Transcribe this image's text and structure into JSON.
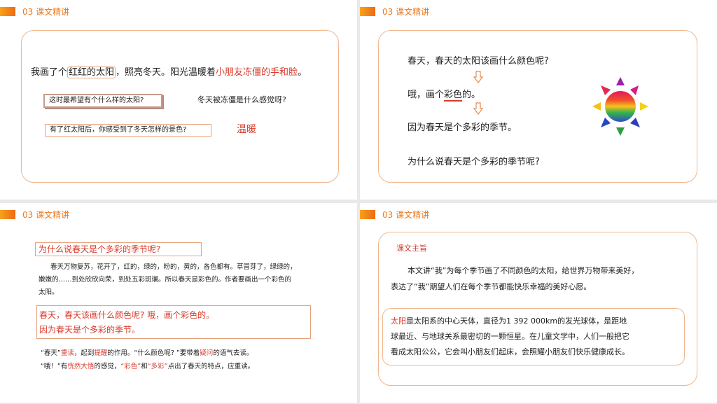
{
  "header": {
    "label": "03 课文精讲"
  },
  "slide1": {
    "sentence_pre": "我画了个",
    "sentence_boxed": "红红的太阳",
    "sentence_mid": "，照亮冬天。阳光温暖着",
    "sentence_red": "小朋友冻僵的手和脸",
    "sentence_end": "。",
    "q1": "这时最希望有个什么样的太阳?",
    "q1_answer": "冬天被冻僵是什么感觉呀?",
    "q2": "有了红太阳后，你感受到了冬天怎样的景色?",
    "q2_answer": "温暖"
  },
  "slide2": {
    "line1": "春天，春天的太阳该画什么颜色呢?",
    "line2_pre": "哦，画个",
    "line2_em": "彩色",
    "line2_end": "的。",
    "line3": "因为春天是个多彩的季节。",
    "line4": "为什么说春天是个多彩的季节呢?"
  },
  "slide3": {
    "question": "为什么说春天是个多彩的季节呢?",
    "para_line1": "春天万物复苏，花开了，红的，绿的，粉的，黄的，各色都有。草冒芽了，绿绿的，",
    "para_line2": "嫩嫩的……到处欣欣向荣，到处五彩斑斓。所以春天是彩色的。作者要画出一个彩色的",
    "para_line3": "太阳。",
    "quote_line1": "春天，春天该画什么颜色呢? 哦，画个彩色的。",
    "quote_line2": "因为春天是个多彩的季节。",
    "n1_a": "“春天”",
    "n1_b": "重读",
    "n1_c": "，起到",
    "n1_d": "提醒",
    "n1_e": "的作用。“什么颜色呢? ”要带着",
    "n1_f": "疑问",
    "n1_g": "的语气去读。",
    "n2_a": "“哦！”有",
    "n2_b": "恍然大悟",
    "n2_c": "的感觉，",
    "n2_d": "“彩色”",
    "n2_e": "和",
    "n2_f": "“多彩”",
    "n2_g": "点出了春天的特点，应重读。"
  },
  "slide4": {
    "title": "课文主旨",
    "para1_line1": "本文讲“我”为每个季节画了不同颜色的太阳，给世界万物带来美好，",
    "para1_line2": "表达了“我”期望人们在每个季节都能快乐幸福的美好心愿。",
    "sun_word": "太阳",
    "para2_line1_rest": "是太阳系的中心天体，直径为1 392 000km的发光球体，是距地",
    "para2_line2": "球最近、与地球关系最密切的一颗恒星。在儿童文学中，人们一般把它",
    "para2_line3": "看成太阳公公，它会叫小朋友们起床，会照耀小朋友们快乐健康成长。"
  },
  "colors": {
    "accent": "#ef7a1e",
    "red": "#d93a2b",
    "border": "#f1b78e"
  }
}
